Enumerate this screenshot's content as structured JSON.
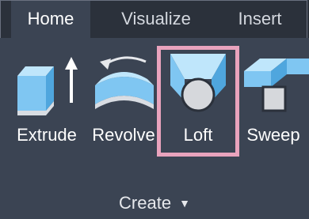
{
  "tabs": [
    {
      "label": "Home",
      "active": true
    },
    {
      "label": "Visualize",
      "active": false
    },
    {
      "label": "Insert",
      "active": false
    }
  ],
  "tools": [
    {
      "label": "Extrude",
      "icon": "extrude-icon",
      "highlighted": false
    },
    {
      "label": "Revolve",
      "icon": "revolve-icon",
      "highlighted": false
    },
    {
      "label": "Loft",
      "icon": "loft-icon",
      "highlighted": true
    },
    {
      "label": "Sweep",
      "icon": "sweep-icon",
      "highlighted": false
    }
  ],
  "panel": {
    "title": "Create",
    "caret_icon": "dropdown-caret-icon"
  },
  "colors": {
    "ribbon_bg": "#3b4453",
    "tabbar_bg": "#2b313b",
    "highlight": "#e9a3bd",
    "icon_blue": "#7fc6f2"
  }
}
